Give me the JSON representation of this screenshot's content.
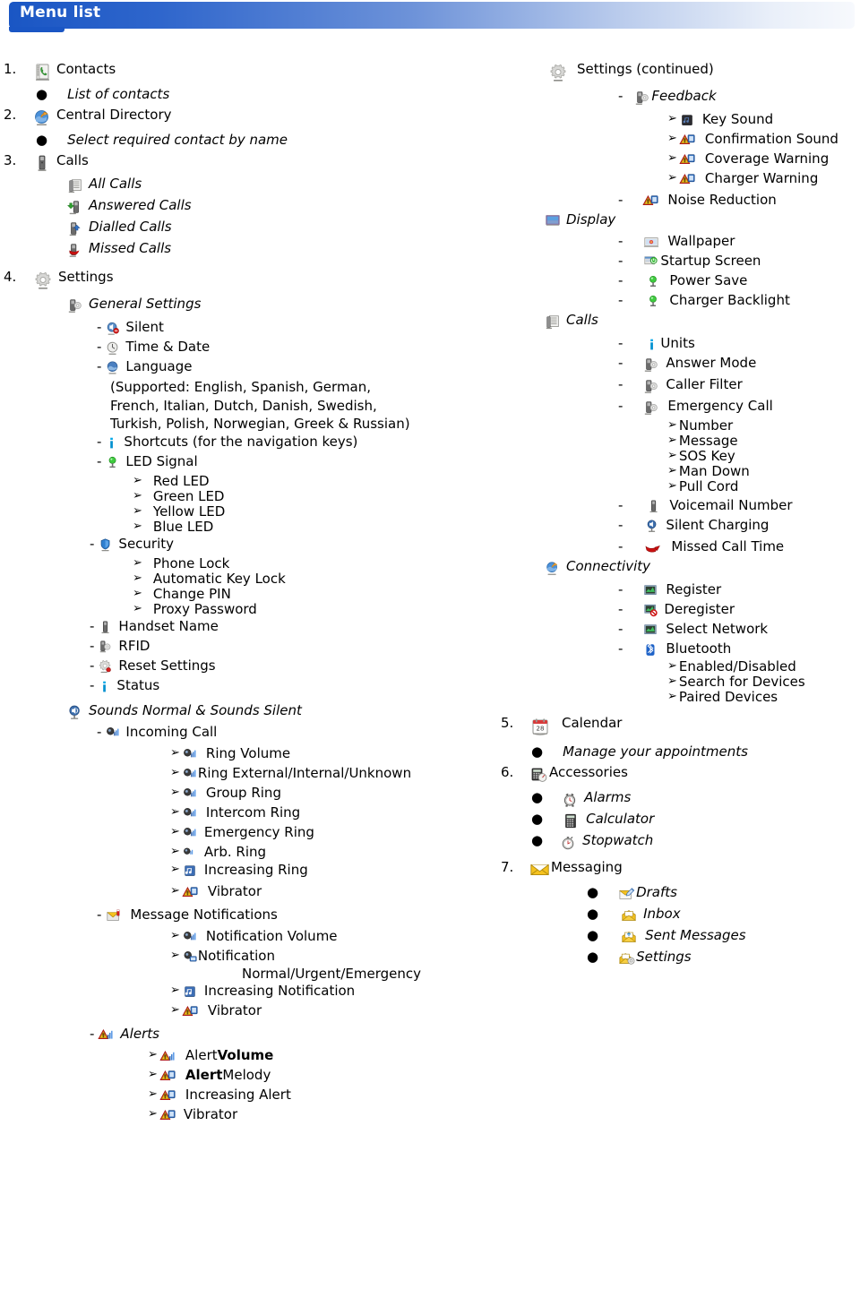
{
  "banner": {
    "title": "Menu list"
  },
  "left": {
    "items": [
      {
        "num": "1.",
        "icon": "contacts-book-icon",
        "label": "Contacts"
      },
      {
        "bullet": true,
        "label": "List of contacts",
        "italic": true
      },
      {
        "num": "2.",
        "icon": "central-directory-globe-icon",
        "label": "Central Directory"
      },
      {
        "bullet": true,
        "label": "Select required contact by name",
        "italic": true
      },
      {
        "num": "3.",
        "icon": "handset-icon",
        "label": "Calls"
      },
      {
        "icon": "all-calls-icon",
        "label": "All Calls",
        "italic": true
      },
      {
        "icon": "answered-calls-icon",
        "label": "Answered Calls",
        "italic": true
      },
      {
        "icon": "dialled-calls-icon",
        "label": "Dialled Calls",
        "italic": true
      },
      {
        "icon": "missed-calls-icon",
        "label": "Missed Calls",
        "italic": true
      },
      {
        "num": "4.",
        "icon": "settings-gear-icon",
        "label": "Settings"
      },
      {
        "icon": "general-settings-icon",
        "label": "General Settings",
        "italic": true
      },
      {
        "dash": true,
        "icon": "silent-icon",
        "label": "Silent"
      },
      {
        "dash": true,
        "icon": "clock-icon",
        "label": "Time & Date"
      },
      {
        "dash": true,
        "icon": "language-globe-icon",
        "label": "Language"
      }
    ],
    "language_note": "(Supported: English, Spanish, German, French, Italian, Dutch, Danish, Swedish, Turkish, Polish, Norwegian, Greek & Russian)",
    "language_note_lines": [
      "(Supported: English, Spanish, German,",
      "French, Italian, Dutch, Danish, Swedish,",
      "Turkish, Polish, Norwegian, Greek & Russian)"
    ],
    "shortcuts": {
      "dash": true,
      "icon": "info-icon",
      "label": "Shortcuts (for the navigation keys)"
    },
    "led_signal": {
      "dash": true,
      "icon": "led-icon",
      "label": "LED Signal"
    },
    "led_children": [
      {
        "label": "Red LED"
      },
      {
        "label": "Green LED"
      },
      {
        "label": "Yellow LED"
      },
      {
        "label": "Blue LED"
      }
    ],
    "security": {
      "dash": true,
      "icon": "security-shield-icon",
      "label": "Security"
    },
    "security_children": [
      {
        "label": "Phone Lock"
      },
      {
        "label": "Automatic Key Lock"
      },
      {
        "label": "Change PIN"
      },
      {
        "label": "Proxy Password"
      }
    ],
    "general_tail": [
      {
        "dash": true,
        "icon": "handset-icon",
        "label": "Handset Name"
      },
      {
        "dash": true,
        "icon": "rfid-icon",
        "label": "RFID"
      },
      {
        "dash": true,
        "icon": "reset-settings-icon",
        "label": "Reset Settings"
      },
      {
        "dash": true,
        "icon": "info-icon",
        "label": "Status"
      }
    ],
    "sounds": {
      "icon": "sounds-icon",
      "label": "Sounds Normal & Sounds Silent",
      "italic": true
    },
    "incoming_call": {
      "dash": true,
      "icon": "ring-volume-icon",
      "label": "Incoming Call"
    },
    "incoming_children": [
      {
        "icon": "ring-volume-icon",
        "label": "Ring Volume"
      },
      {
        "icon": "ring-volume-icon",
        "label": "Ring External/Internal/Unknown",
        "tight": true
      },
      {
        "icon": "ring-volume-icon",
        "label": "Group Ring"
      },
      {
        "icon": "ring-volume-icon",
        "label": "Intercom Ring"
      },
      {
        "icon": "ring-volume-icon",
        "label": "Emergency Ring"
      },
      {
        "icon": "arb-ring-icon",
        "label": "Arb. Ring"
      },
      {
        "icon": "music-note-icon",
        "label": "Increasing Ring"
      },
      {
        "icon": "vibrator-icon",
        "label": "Vibrator"
      }
    ],
    "message_notifications": {
      "dash": true,
      "icon": "message-notification-icon",
      "label": "Message Notifications"
    },
    "message_children": [
      {
        "icon": "ring-volume-icon",
        "label": "Notification Volume"
      },
      {
        "icon": "notification-icon",
        "label": "Notification",
        "tight": true
      },
      {
        "icon": "music-note-icon",
        "label": "Increasing Notification"
      },
      {
        "icon": "vibrator-icon",
        "label": "Vibrator"
      }
    ],
    "notification_modes": "Normal/Urgent/Emergency",
    "alerts": {
      "dash": true,
      "icon": "alert-icon",
      "label": "Alerts",
      "italic": true
    },
    "alerts_children": [
      {
        "icon": "alert-icon",
        "label_plain": "Alert ",
        "label_bold": "Volume"
      },
      {
        "icon": "vibrator-icon",
        "label_bold": "Alert",
        "label_plain": " Melody",
        "bold_first": true
      },
      {
        "icon": "vibrator-icon",
        "label_plain": "Increasing Alert"
      },
      {
        "icon": "vibrator-icon",
        "label_plain": "Vibrator"
      }
    ]
  },
  "right": {
    "settings_continued": {
      "icon": "settings-gear-icon",
      "label": "Settings (continued)"
    },
    "feedback": {
      "dash": true,
      "icon": "general-settings-icon",
      "label": "Feedback",
      "italic": true
    },
    "feedback_children": [
      {
        "icon": "key-sound-icon",
        "label": "Key Sound"
      },
      {
        "icon": "vibrator-icon",
        "label": "Confirmation Sound"
      },
      {
        "icon": "vibrator-icon",
        "label": "Coverage Warning"
      },
      {
        "icon": "vibrator-icon",
        "label": "Charger Warning"
      }
    ],
    "noise_reduction": {
      "dash": true,
      "icon": "vibrator-icon",
      "label": "Noise Reduction"
    },
    "display": {
      "icon": "display-icon",
      "label": "Display",
      "italic": true
    },
    "display_children": [
      {
        "dash": true,
        "icon": "wallpaper-icon",
        "label": "Wallpaper"
      },
      {
        "dash": true,
        "icon": "startup-screen-icon",
        "label": "Startup Screen"
      },
      {
        "dash": true,
        "icon": "led-icon",
        "label": "Power Save"
      },
      {
        "dash": true,
        "icon": "led-icon",
        "label": "Charger Backlight"
      }
    ],
    "calls": {
      "icon": "all-calls-icon",
      "label": "Calls",
      "italic": true
    },
    "calls_children": [
      {
        "dash": true,
        "icon": "info-icon",
        "label": "Units"
      },
      {
        "dash": true,
        "icon": "general-settings-icon",
        "label": "Answer Mode"
      },
      {
        "dash": true,
        "icon": "general-settings-icon",
        "label": "Caller Filter"
      },
      {
        "dash": true,
        "icon": "general-settings-icon",
        "label": "Emergency Call"
      }
    ],
    "emergency_children": [
      {
        "label": "Number"
      },
      {
        "label": "Message"
      },
      {
        "label": "SOS Key"
      },
      {
        "label": "Man Down"
      },
      {
        "label": "Pull Cord"
      }
    ],
    "calls_tail": [
      {
        "dash": true,
        "icon": "handset-icon",
        "label": "Voicemail Number"
      },
      {
        "dash": true,
        "icon": "silent-charging-icon",
        "label": "Silent Charging"
      },
      {
        "dash": true,
        "icon": "missed-call-time-icon",
        "label": "Missed Call Time"
      }
    ],
    "connectivity": {
      "icon": "central-directory-globe-icon",
      "label": "Connectivity",
      "italic": true
    },
    "connectivity_children": [
      {
        "dash": true,
        "icon": "network-icon",
        "label": "Register"
      },
      {
        "dash": true,
        "icon": "deregister-icon",
        "label": "Deregister"
      },
      {
        "dash": true,
        "icon": "network-icon",
        "label": "Select Network"
      },
      {
        "dash": true,
        "icon": "bluetooth-icon",
        "label": "Bluetooth"
      }
    ],
    "bluetooth_children": [
      {
        "label": "Enabled/Disabled"
      },
      {
        "label": "Search for Devices"
      },
      {
        "label": "Paired Devices"
      }
    ],
    "calendar": {
      "num": "5.",
      "icon": "calendar-icon",
      "label": "Calendar"
    },
    "calendar_bullet": {
      "label": "Manage your appointments",
      "italic": true
    },
    "accessories": {
      "num": "6.",
      "icon": "accessories-icon",
      "label": "Accessories"
    },
    "accessories_children": [
      {
        "icon": "alarm-clock-icon",
        "label": "Alarms",
        "italic": true
      },
      {
        "icon": "calculator-icon",
        "label": "Calculator",
        "italic": true
      },
      {
        "icon": "stopwatch-icon",
        "label": "Stopwatch",
        "italic": true
      }
    ],
    "messaging": {
      "num": "7.",
      "icon": "messaging-envelope-icon",
      "label": "Messaging"
    },
    "messaging_children": [
      {
        "icon": "drafts-icon",
        "label": "Drafts",
        "italic": true
      },
      {
        "icon": "inbox-icon",
        "label": "Inbox",
        "italic": true
      },
      {
        "icon": "sent-messages-icon",
        "label": "Sent Messages",
        "italic": true
      },
      {
        "icon": "messaging-settings-icon",
        "label": "Settings",
        "italic": true
      }
    ]
  },
  "glyphs": {
    "arrow": "➢",
    "bullet": "●",
    "dash": "-"
  },
  "colors": {
    "banner_start": "#1a56c4",
    "banner_end": "#f7f9fd",
    "text": "#000000"
  }
}
